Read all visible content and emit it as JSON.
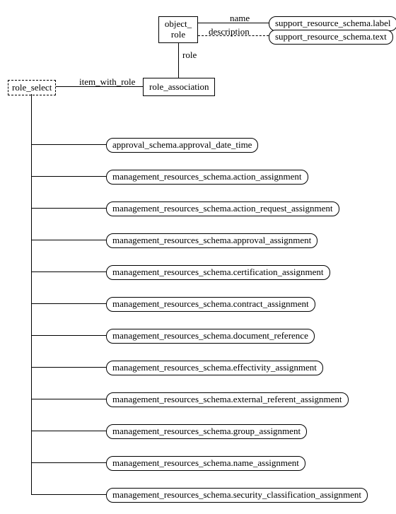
{
  "entities": {
    "object_role": "object_\nrole",
    "role_association": "role_association",
    "role_select": "role_select"
  },
  "attrs": {
    "name": "name",
    "description": "description",
    "role": "role",
    "item_with_role": "item_with_role"
  },
  "types": {
    "label": "support_resource_schema.label",
    "text": "support_resource_schema.text"
  },
  "select_members": [
    "approval_schema.approval_date_time",
    "management_resources_schema.action_assignment",
    "management_resources_schema.action_request_assignment",
    "management_resources_schema.approval_assignment",
    "management_resources_schema.certification_assignment",
    "management_resources_schema.contract_assignment",
    "management_resources_schema.document_reference",
    "management_resources_schema.effectivity_assignment",
    "management_resources_schema.external_referent_assignment",
    "management_resources_schema.group_assignment",
    "management_resources_schema.name_assignment",
    "management_resources_schema.security_classification_assignment"
  ]
}
